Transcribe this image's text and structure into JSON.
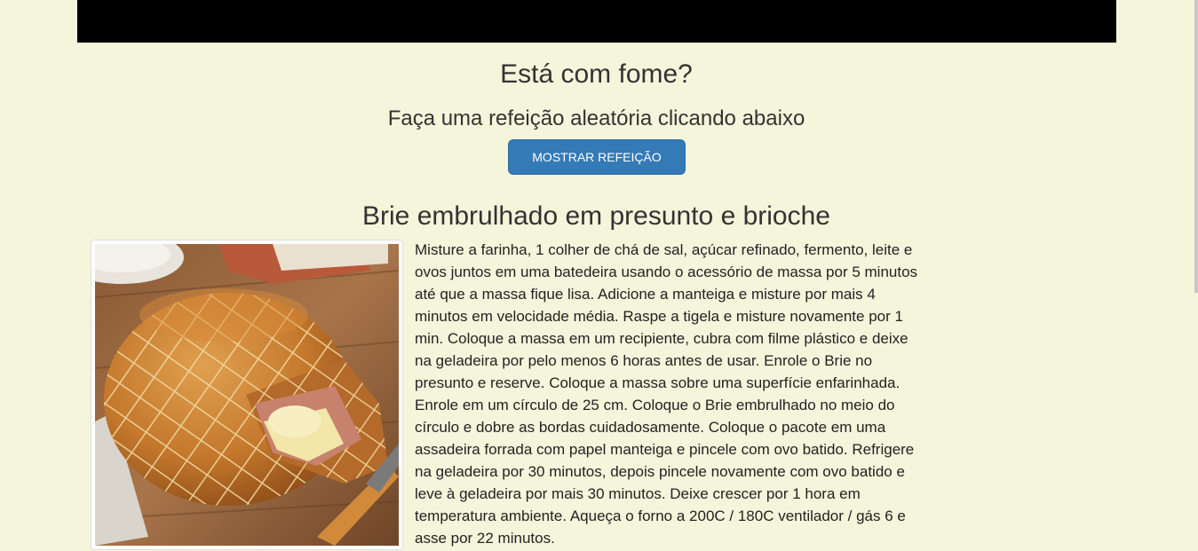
{
  "header": {
    "title": "Está com fome?",
    "subtitle": "Faça uma refeição aleatória clicando abaixo",
    "button_label": "MOSTRAR REFEIÇÃO"
  },
  "meal": {
    "name": "Brie embrulhado em presunto e brioche",
    "instructions": "Misture a farinha, 1 colher de chá de sal, açúcar refinado, fermento, leite e ovos juntos em uma batedeira usando o acessório de massa por 5 minutos até que a massa fique lisa. Adicione a manteiga e misture por mais 4 minutos em velocidade média. Raspe a tigela e misture novamente por 1 min. Coloque a massa em um recipiente, cubra com filme plástico e deixe na geladeira por pelo menos 6 horas antes de usar. Enrole o Brie no presunto e reserve. Coloque a massa sobre uma superfície enfarinhada. Enrole em um círculo de 25 cm. Coloque o Brie embrulhado no meio do círculo e dobre as bordas cuidadosamente. Coloque o pacote em uma assadeira forrada com papel manteiga e pincele com ovo batido. Refrigere na geladeira por 30 minutos, depois pincele novamente com ovo batido e leve à geladeira por mais 30 minutos. Deixe crescer por 1 hora em temperatura ambiente. Aqueça o forno a 200C / 180C ventilador / gás 6 e asse por 22 minutos."
  },
  "colors": {
    "page_background": "#f5f5dc",
    "top_bar": "#000000",
    "button": "#337ab7",
    "button_text": "#ffffff"
  }
}
